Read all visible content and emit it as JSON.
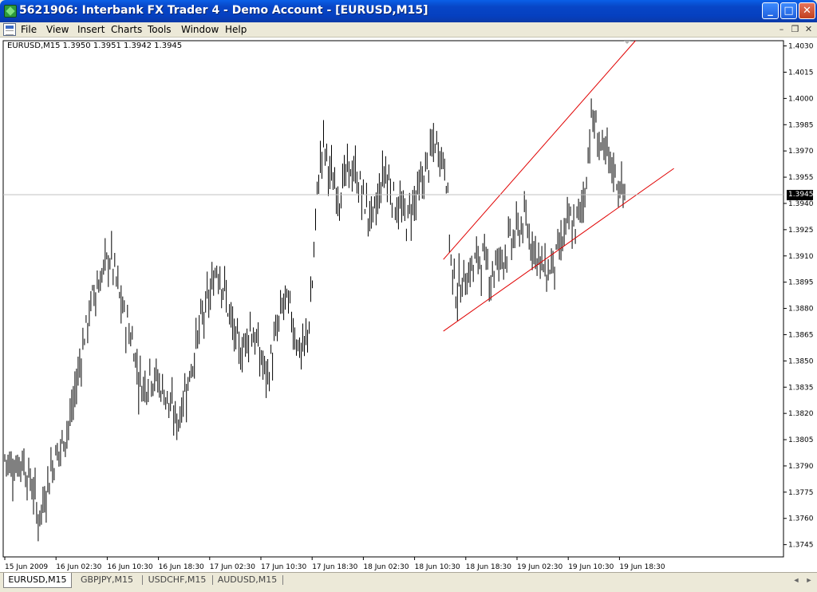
{
  "window": {
    "title": "5621906: Interbank FX Trader 4 - Demo Account - [EURUSD,M15]",
    "minimize": "_",
    "maximize": "□",
    "close": "✕"
  },
  "menu": {
    "items": [
      "File",
      "View",
      "Insert",
      "Charts",
      "Tools",
      "Window",
      "Help"
    ],
    "mdi_minimize": "–",
    "mdi_restore": "❐",
    "mdi_close": "✕"
  },
  "chart_info": {
    "symbol_line": "EURUSD,M15  1.3950 1.3951 1.3942 1.3945",
    "current_price": "1.3945"
  },
  "chart_data": {
    "type": "bar",
    "symbol": "EURUSD",
    "timeframe": "M15",
    "ylim": [
      1.3738,
      1.4033
    ],
    "y_ticks": [
      "1.4030",
      "1.4015",
      "1.4000",
      "1.3985",
      "1.3970",
      "1.3955",
      "1.3940",
      "1.3925",
      "1.3910",
      "1.3895",
      "1.3880",
      "1.3865",
      "1.3850",
      "1.3835",
      "1.3820",
      "1.3805",
      "1.3790",
      "1.3775",
      "1.3760",
      "1.3745"
    ],
    "x_ticks": [
      "15 Jun 2009",
      "16 Jun 02:30",
      "16 Jun 10:30",
      "16 Jun 18:30",
      "17 Jun 02:30",
      "17 Jun 10:30",
      "17 Jun 18:30",
      "18 Jun 02:30",
      "18 Jun 10:30",
      "18 Jun 18:30",
      "19 Jun 02:30",
      "19 Jun 10:30",
      "19 Jun 18:30"
    ],
    "close_series": [
      1.3795,
      1.379,
      1.379,
      1.3795,
      1.3785,
      1.3778,
      1.376,
      1.377,
      1.3785,
      1.3795,
      1.38,
      1.381,
      1.382,
      1.384,
      1.386,
      1.3875,
      1.389,
      1.3895,
      1.3905,
      1.391,
      1.3895,
      1.388,
      1.387,
      1.386,
      1.384,
      1.3835,
      1.3845,
      1.384,
      1.3835,
      1.383,
      1.382,
      1.3815,
      1.383,
      1.384,
      1.3855,
      1.387,
      1.388,
      1.389,
      1.3905,
      1.3895,
      1.388,
      1.3865,
      1.3855,
      1.386,
      1.387,
      1.386,
      1.385,
      1.384,
      1.3855,
      1.387,
      1.3885,
      1.388,
      1.3865,
      1.3855,
      1.386,
      1.389,
      1.395,
      1.3975,
      1.396,
      1.395,
      1.3945,
      1.3955,
      1.396,
      1.3955,
      1.3945,
      1.3935,
      1.393,
      1.3945,
      1.396,
      1.395,
      1.394,
      1.3935,
      1.393,
      1.394,
      1.3945,
      1.3955,
      1.3965,
      1.3975,
      1.397,
      1.396,
      1.39,
      1.389,
      1.3895,
      1.39,
      1.3905,
      1.391,
      1.3905,
      1.39,
      1.3905,
      1.391,
      1.3915,
      1.392,
      1.3925,
      1.393,
      1.392,
      1.3915,
      1.3905,
      1.39,
      1.3905,
      1.391,
      1.392,
      1.393,
      1.3925,
      1.3935,
      1.395,
      1.399,
      1.398,
      1.397,
      1.3965,
      1.396,
      1.395,
      1.3945
    ],
    "trendlines": [
      {
        "from": [
          "18 Jun 15:00",
          1.3908
        ],
        "to": [
          "19 Jun 21:00",
          1.4033
        ]
      },
      {
        "from": [
          "18 Jun 15:00",
          1.3867
        ],
        "to": [
          "20 Jun 03:00",
          1.396
        ]
      }
    ],
    "hline": 1.3945,
    "colors": {
      "bars": "#000000",
      "trendline": "#e00000",
      "hline": "#c0c0c0"
    }
  },
  "tabs": [
    {
      "label": "EURUSD,M15",
      "active": true
    },
    {
      "label": "GBPJPY,M15",
      "active": false
    },
    {
      "label": "USDCHF,M15",
      "active": false
    },
    {
      "label": "AUDUSD,M15",
      "active": false
    }
  ]
}
